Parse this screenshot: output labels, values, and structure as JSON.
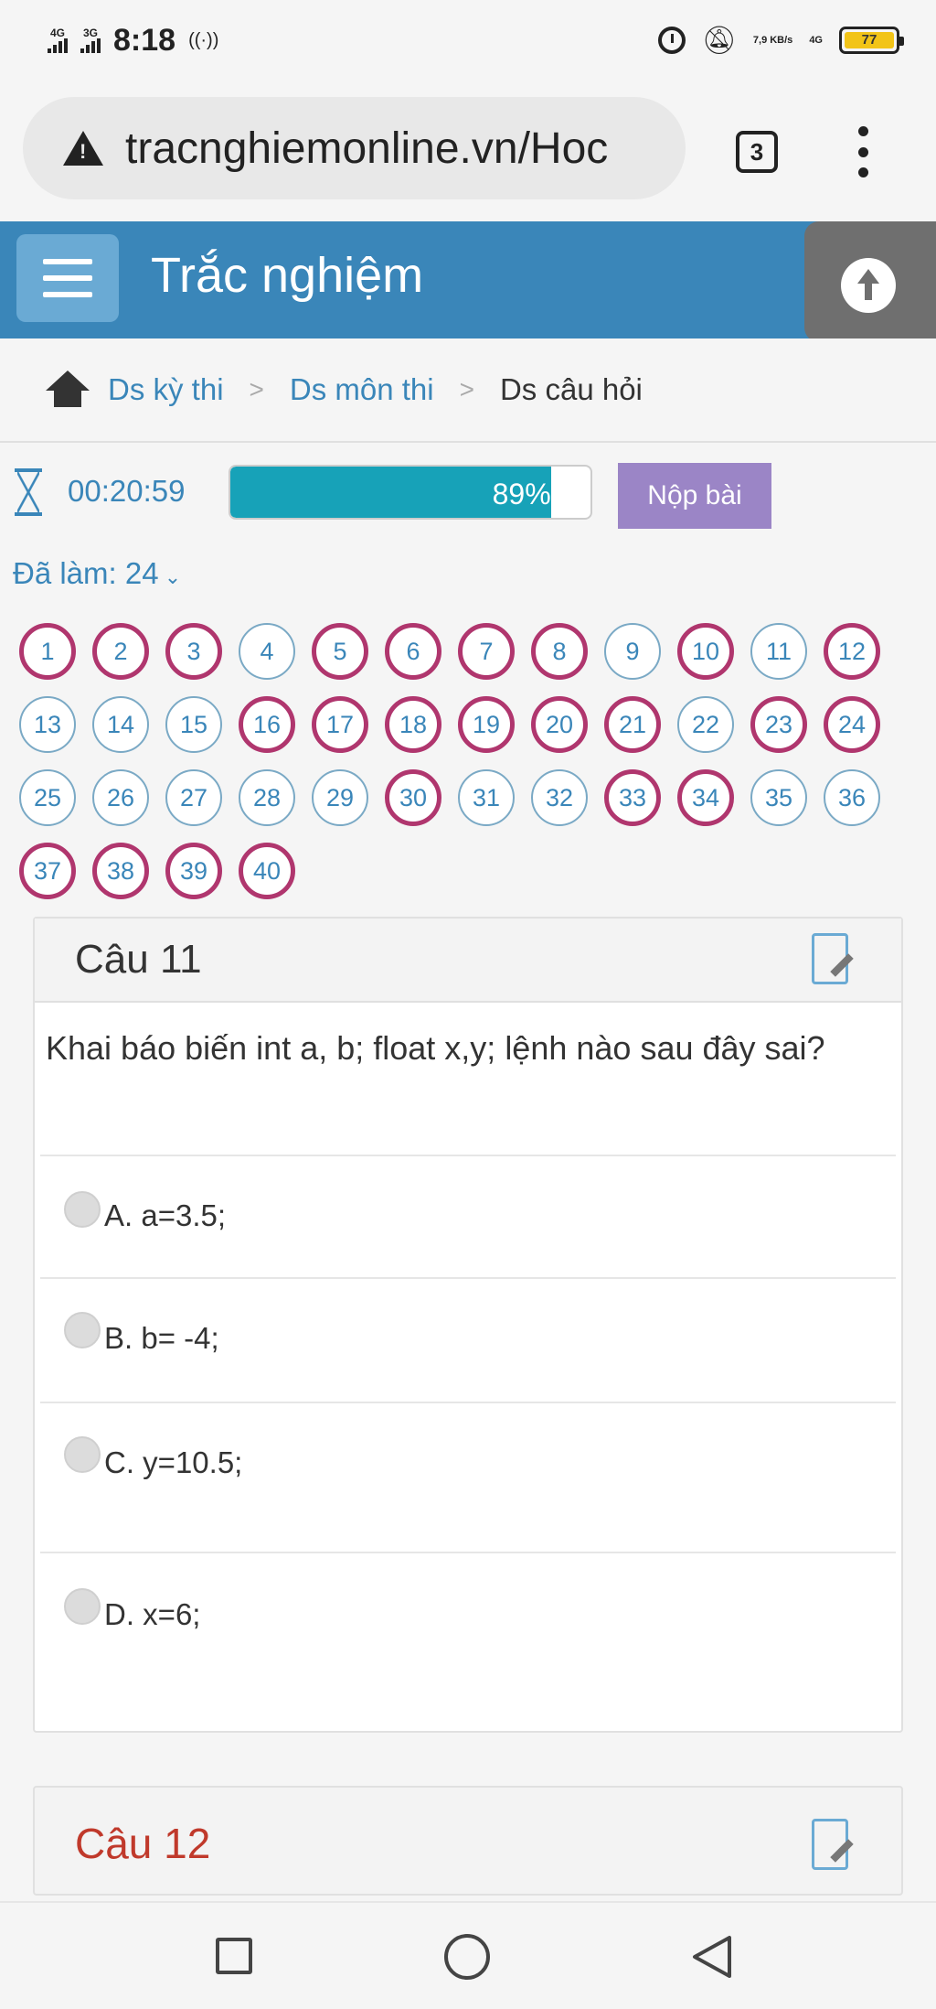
{
  "status_bar": {
    "time": "8:18",
    "sim1": "4G",
    "sim2": "3G",
    "net_speed": "7,9 KB/s",
    "net_type": "4G",
    "battery": "77"
  },
  "browser": {
    "url": "tracnghiemonline.vn/Hoc",
    "tab_count": "3"
  },
  "header": {
    "title": "Trắc nghiệm"
  },
  "breadcrumb": {
    "items": [
      "Ds kỳ thi",
      "Ds môn thi",
      "Ds câu hỏi"
    ],
    "separator": ">"
  },
  "quiz": {
    "timer": "00:20:59",
    "progress_percent": 89,
    "progress_label": "89%",
    "submit_label": "Nộp bài",
    "done_label": "Đã làm: 24",
    "questions": [
      {
        "n": "1",
        "done": true
      },
      {
        "n": "2",
        "done": true
      },
      {
        "n": "3",
        "done": true
      },
      {
        "n": "4",
        "done": false
      },
      {
        "n": "5",
        "done": true
      },
      {
        "n": "6",
        "done": true
      },
      {
        "n": "7",
        "done": true
      },
      {
        "n": "8",
        "done": true
      },
      {
        "n": "9",
        "done": false
      },
      {
        "n": "10",
        "done": true
      },
      {
        "n": "11",
        "done": false
      },
      {
        "n": "12",
        "done": true
      },
      {
        "n": "13",
        "done": false
      },
      {
        "n": "14",
        "done": false
      },
      {
        "n": "15",
        "done": false
      },
      {
        "n": "16",
        "done": true
      },
      {
        "n": "17",
        "done": true
      },
      {
        "n": "18",
        "done": true
      },
      {
        "n": "19",
        "done": true
      },
      {
        "n": "20",
        "done": true
      },
      {
        "n": "21",
        "done": true
      },
      {
        "n": "22",
        "done": false
      },
      {
        "n": "23",
        "done": true
      },
      {
        "n": "24",
        "done": true
      },
      {
        "n": "25",
        "done": false
      },
      {
        "n": "26",
        "done": false
      },
      {
        "n": "27",
        "done": false
      },
      {
        "n": "28",
        "done": false
      },
      {
        "n": "29",
        "done": false
      },
      {
        "n": "30",
        "done": true
      },
      {
        "n": "31",
        "done": false
      },
      {
        "n": "32",
        "done": false
      },
      {
        "n": "33",
        "done": true
      },
      {
        "n": "34",
        "done": true
      },
      {
        "n": "35",
        "done": false
      },
      {
        "n": "36",
        "done": false
      },
      {
        "n": "37",
        "done": true
      },
      {
        "n": "38",
        "done": true
      },
      {
        "n": "39",
        "done": true
      },
      {
        "n": "40",
        "done": true
      }
    ]
  },
  "current_question": {
    "title": "Câu 11",
    "text": "Khai báo biến int a, b; float x,y; lệnh nào sau đây sai?",
    "options": [
      "A. a=3.5;",
      "B. b= -4;",
      "C. y=10.5;",
      "D. x=6;"
    ]
  },
  "next_question": {
    "title": "Câu 12"
  },
  "colors": {
    "header_bg": "#3a86b9",
    "progress": "#17a2b8",
    "submit": "#9b85c6",
    "answered_ring": "#b0366e",
    "next_title": "#c0392b"
  }
}
